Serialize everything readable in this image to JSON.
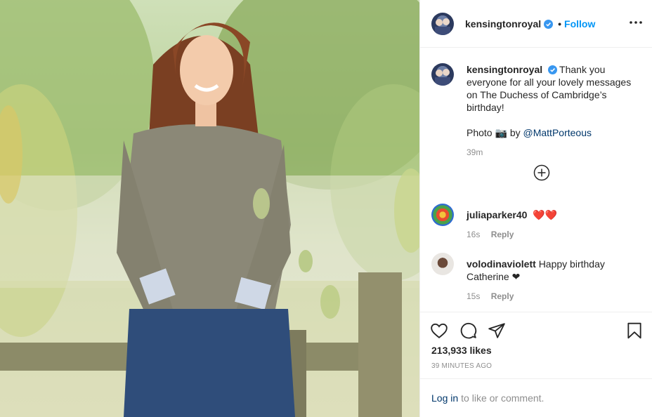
{
  "post": {
    "image_alt": "",
    "author": "kensingtonroyal",
    "follow_label": "Follow",
    "separator": "•"
  },
  "caption": {
    "username": "kensingtonroyal",
    "text": "Thank you everyone for all your lovely messages on The Duchess of Cambridge’s birthday!",
    "photo_prefix": "Photo",
    "camera_glyph": "📷",
    "photo_by": "by",
    "mention": "@MattPorteous",
    "time": "39m"
  },
  "comments": [
    {
      "username": "juliaparker40",
      "text": "❤️❤️",
      "time": "16s",
      "reply_label": "Reply"
    },
    {
      "username": "volodinaviolett",
      "text": "Happy birthday Catherine ❤",
      "time": "15s",
      "reply_label": "Reply"
    }
  ],
  "actions": {
    "likes": "213,933 likes",
    "time_ago": "39 MINUTES AGO",
    "login_link": "Log in",
    "login_suffix": "to like or comment."
  },
  "icons": {
    "verified": "verified-badge-icon",
    "more": "more-options-icon",
    "load_more": "load-more-icon",
    "like": "heart-icon",
    "comment": "comment-icon",
    "share": "share-icon",
    "save": "bookmark-icon"
  },
  "colors": {
    "accent": "#0095f6",
    "link": "#00376b",
    "muted": "#8e8e8e",
    "heart": "#ed4956"
  }
}
